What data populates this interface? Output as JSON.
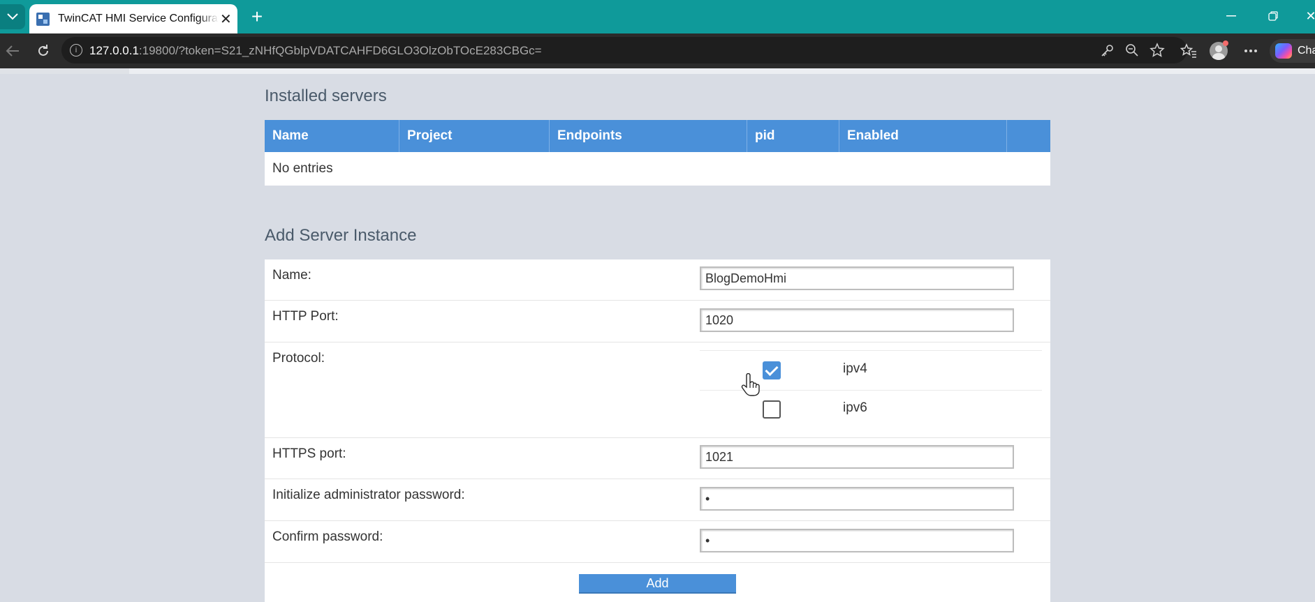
{
  "browser": {
    "tab_title": "TwinCAT HMI Service Configuration",
    "url_host": "127.0.0.1",
    "url_rest": ":19800/?token=S21_zNHfQGblpVDATCAHFD6GLO3OlzObTOcE283CBGc=",
    "copilot_label": "Cha",
    "icons": [
      "tab-list-icon",
      "new-tab-icon",
      "minimize-icon",
      "restore-icon",
      "close-icon",
      "back-icon",
      "reload-icon",
      "info-icon",
      "key-icon",
      "zoom-out-icon",
      "favorite-star-icon",
      "favorites-icon",
      "profile-icon",
      "more-icon",
      "copilot-icon"
    ]
  },
  "installed_servers": {
    "title": "Installed servers",
    "columns": [
      "Name",
      "Project",
      "Endpoints",
      "pid",
      "Enabled",
      ""
    ],
    "empty_text": "No entries"
  },
  "add_server": {
    "title": "Add Server Instance",
    "name_label": "Name:",
    "name_value": "BlogDemoHmi",
    "http_port_label": "HTTP Port:",
    "http_port_value": "1020",
    "protocol_label": "Protocol:",
    "protocol_options": [
      {
        "label": "ipv4",
        "checked": true
      },
      {
        "label": "ipv6",
        "checked": false
      }
    ],
    "https_port_label": "HTTPS port:",
    "https_port_value": "1021",
    "admin_password_label": "Initialize administrator password:",
    "admin_password_value": "•",
    "confirm_password_label": "Confirm password:",
    "confirm_password_value": "•",
    "add_button_label": "Add"
  },
  "colors": {
    "tabbar": "#0f9a9a",
    "toolbar": "#2b2b2b",
    "page_bg": "#d8dce4",
    "accent": "#4a90d9"
  }
}
